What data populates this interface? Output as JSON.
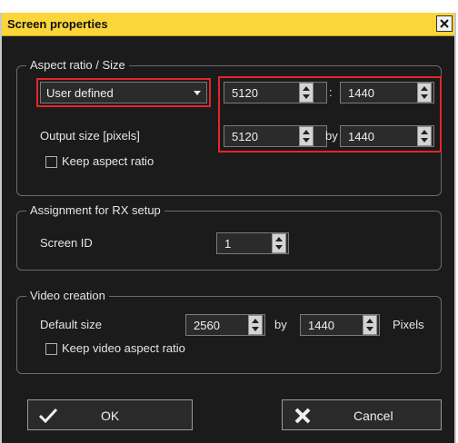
{
  "dialog": {
    "title": "Screen properties"
  },
  "aspect": {
    "legend": "Aspect ratio / Size",
    "preset": "User defined",
    "ratio_w": "5120",
    "ratio_sep": ":",
    "ratio_h": "1440",
    "output_label": "Output size [pixels]",
    "out_w": "5120",
    "by": "by",
    "out_h": "1440",
    "keep_label": "Keep aspect ratio"
  },
  "rx": {
    "legend": "Assignment for RX setup",
    "screen_label": "Screen ID",
    "screen_id": "1"
  },
  "video": {
    "legend": "Video creation",
    "default_label": "Default size",
    "w": "2560",
    "by": "by",
    "h": "1440",
    "units": "Pixels",
    "keep_label": "Keep video aspect ratio"
  },
  "buttons": {
    "ok": "OK",
    "cancel": "Cancel"
  }
}
